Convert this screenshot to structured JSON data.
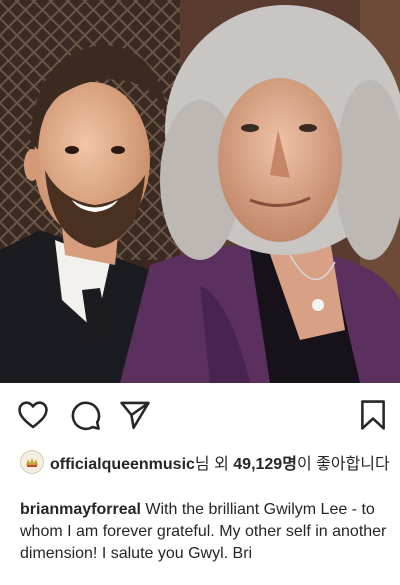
{
  "post": {
    "image_alt": "Two men smiling together in a selfie"
  },
  "actions": {
    "like_icon": "heart-icon",
    "comment_icon": "comment-icon",
    "share_icon": "send-icon",
    "save_icon": "bookmark-icon"
  },
  "likes": {
    "account": "officialqueenmusic",
    "prefix": "님 외 ",
    "count": "49,129명",
    "suffix": "이 좋아합니다"
  },
  "caption": {
    "username": "brianmayforreal",
    "text": "With the brilliant Gwilym Lee - to whom I am forever grateful.  My other self in another dimension!  I salute you Gwyl. Bri"
  },
  "colors": {
    "text": "#262626",
    "background": "#ffffff"
  }
}
